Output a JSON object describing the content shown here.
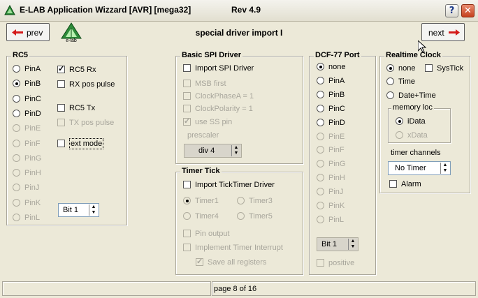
{
  "window": {
    "title": "E-LAB Application Wizzard [AVR] [mega32]",
    "rev": "Rev 4.9",
    "help": "?",
    "close": "✕"
  },
  "nav": {
    "prev": "prev",
    "next": "next",
    "logo_text": "e-lab",
    "page_title": "special driver import I"
  },
  "rc5": {
    "legend": "RC5",
    "pins": [
      {
        "label": "PinA",
        "checked": false,
        "disabled": false
      },
      {
        "label": "PinB",
        "checked": true,
        "disabled": false
      },
      {
        "label": "PinC",
        "checked": false,
        "disabled": false
      },
      {
        "label": "PinD",
        "checked": false,
        "disabled": false
      },
      {
        "label": "PinE",
        "checked": false,
        "disabled": true
      },
      {
        "label": "PinF",
        "checked": false,
        "disabled": true
      },
      {
        "label": "PinG",
        "checked": false,
        "disabled": true
      },
      {
        "label": "PinH",
        "checked": false,
        "disabled": true
      },
      {
        "label": "PinJ",
        "checked": false,
        "disabled": true
      },
      {
        "label": "PinK",
        "checked": false,
        "disabled": true
      },
      {
        "label": "PinL",
        "checked": false,
        "disabled": true
      }
    ],
    "rc5_rx": "RC5 Rx",
    "rx_pos_pulse": "RX pos pulse",
    "rc5_tx": "RC5 Tx",
    "tx_pos_pulse": "TX pos pulse",
    "ext_mode": "ext mode",
    "bit": "Bit 1"
  },
  "spi": {
    "legend": "Basic SPI Driver",
    "import": "Import SPI Driver",
    "msb_first": "MSB first",
    "clock_phase": "ClockPhaseA = 1",
    "clock_polarity": "ClockPolarity = 1",
    "use_ss": "use SS pin",
    "prescaler_label": "prescaler",
    "prescaler_value": "div 4"
  },
  "timer_tick": {
    "legend": "Timer Tick",
    "import": "Import TickTimer Driver",
    "timer1": "Timer1",
    "timer3": "Timer3",
    "timer4": "Timer4",
    "timer5": "Timer5",
    "pin_output": "Pin output",
    "implement": "Implement Timer Interrupt",
    "save_regs": "Save all registers"
  },
  "dcf": {
    "legend": "DCF-77 Port",
    "options": [
      {
        "label": "none",
        "checked": true,
        "disabled": false
      },
      {
        "label": "PinA",
        "checked": false,
        "disabled": false
      },
      {
        "label": "PinB",
        "checked": false,
        "disabled": false
      },
      {
        "label": "PinC",
        "checked": false,
        "disabled": false
      },
      {
        "label": "PinD",
        "checked": false,
        "disabled": false
      },
      {
        "label": "PinE",
        "checked": false,
        "disabled": true
      },
      {
        "label": "PinF",
        "checked": false,
        "disabled": true
      },
      {
        "label": "PinG",
        "checked": false,
        "disabled": true
      },
      {
        "label": "PinH",
        "checked": false,
        "disabled": true
      },
      {
        "label": "PinJ",
        "checked": false,
        "disabled": true
      },
      {
        "label": "PinK",
        "checked": false,
        "disabled": true
      },
      {
        "label": "PinL",
        "checked": false,
        "disabled": true
      }
    ],
    "bit": "Bit 1",
    "positive": "positive"
  },
  "rtc": {
    "legend": "Realtime Clock",
    "none": "none",
    "systick": "SysTick",
    "time": "Time",
    "date_time": "Date+Time",
    "memory_legend": "memory loc",
    "idata": "iData",
    "xdata": "xData",
    "timer_channels": "timer channels",
    "no_timer": "No Timer",
    "alarm": "Alarm"
  },
  "status": {
    "page": "page 8 of 16"
  }
}
